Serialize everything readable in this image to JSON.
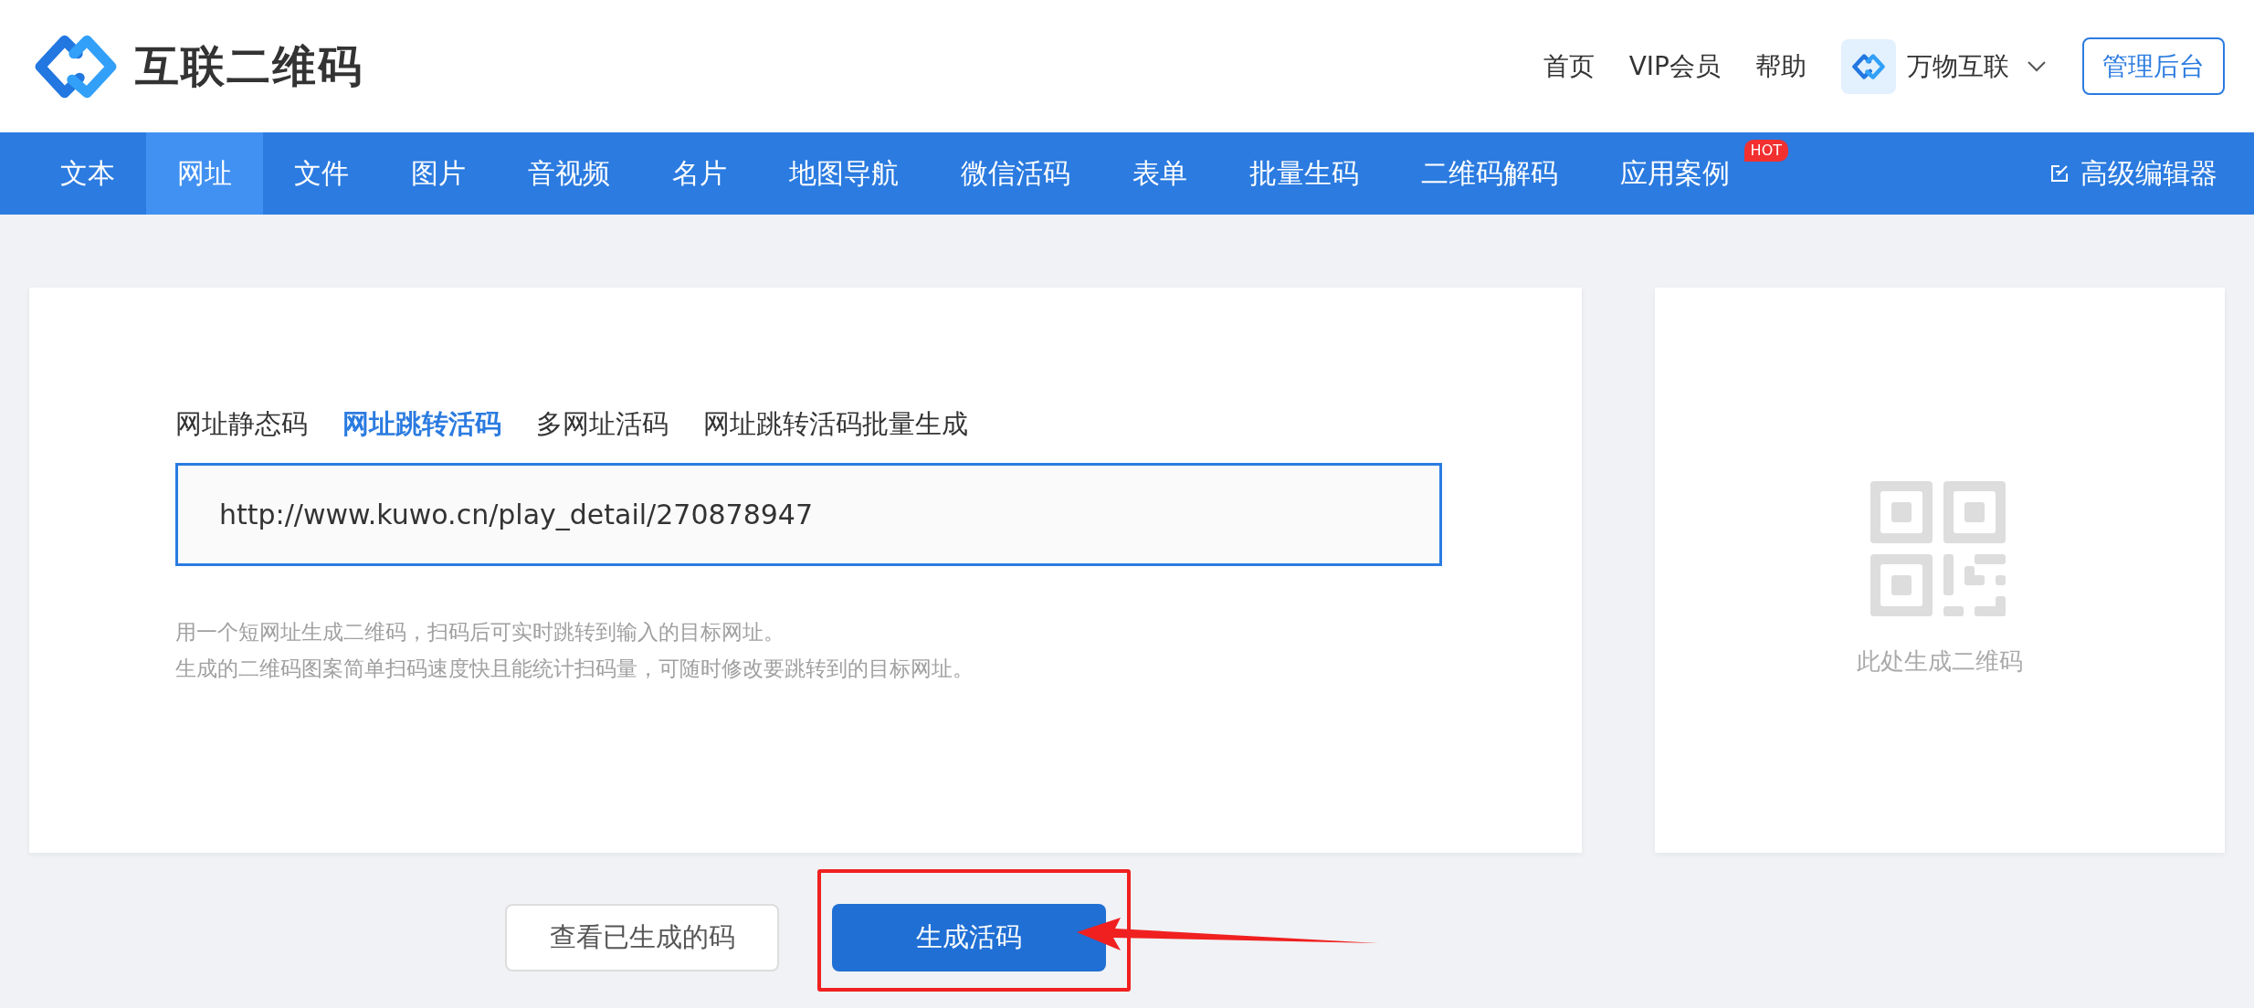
{
  "header": {
    "logo": "互联二维码",
    "links": [
      {
        "label": "首页"
      },
      {
        "label": "VIP会员"
      },
      {
        "label": "帮助"
      }
    ],
    "account": {
      "name": "万物互联"
    },
    "admin_button": "管理后台"
  },
  "nav": {
    "items": [
      {
        "label": "文本",
        "selected": false
      },
      {
        "label": "网址",
        "selected": true
      },
      {
        "label": "文件",
        "selected": false
      },
      {
        "label": "图片",
        "selected": false
      },
      {
        "label": "音视频",
        "selected": false
      },
      {
        "label": "名片",
        "selected": false
      },
      {
        "label": "地图导航",
        "selected": false
      },
      {
        "label": "微信活码",
        "selected": false
      },
      {
        "label": "表单",
        "selected": false
      },
      {
        "label": "批量生码",
        "selected": false
      },
      {
        "label": "二维码解码",
        "selected": false
      },
      {
        "label": "应用案例",
        "selected": false,
        "badge": "HOT"
      }
    ],
    "editor_link": "高级编辑器"
  },
  "generator": {
    "tabs": [
      {
        "label": "网址静态码",
        "selected": false
      },
      {
        "label": "网址跳转活码",
        "selected": true
      },
      {
        "label": "多网址活码",
        "selected": false
      },
      {
        "label": "网址跳转活码批量生成",
        "selected": false
      }
    ],
    "url_field": {
      "value": "http://www.kuwo.cn/play_detail/270878947"
    },
    "hints": [
      "用一个短网址生成二维码，扫码后可实时跳转到输入的目标网址。",
      "生成的二维码图案简单扫码速度快且能统计扫码量，可随时修改要跳转到的目标网址。"
    ]
  },
  "preview": {
    "caption": "此处生成二维码"
  },
  "actions": [
    {
      "label": "查看已生成的码",
      "kind": "secondary"
    },
    {
      "label": "生成活码",
      "kind": "primary",
      "annotated": true
    }
  ]
}
